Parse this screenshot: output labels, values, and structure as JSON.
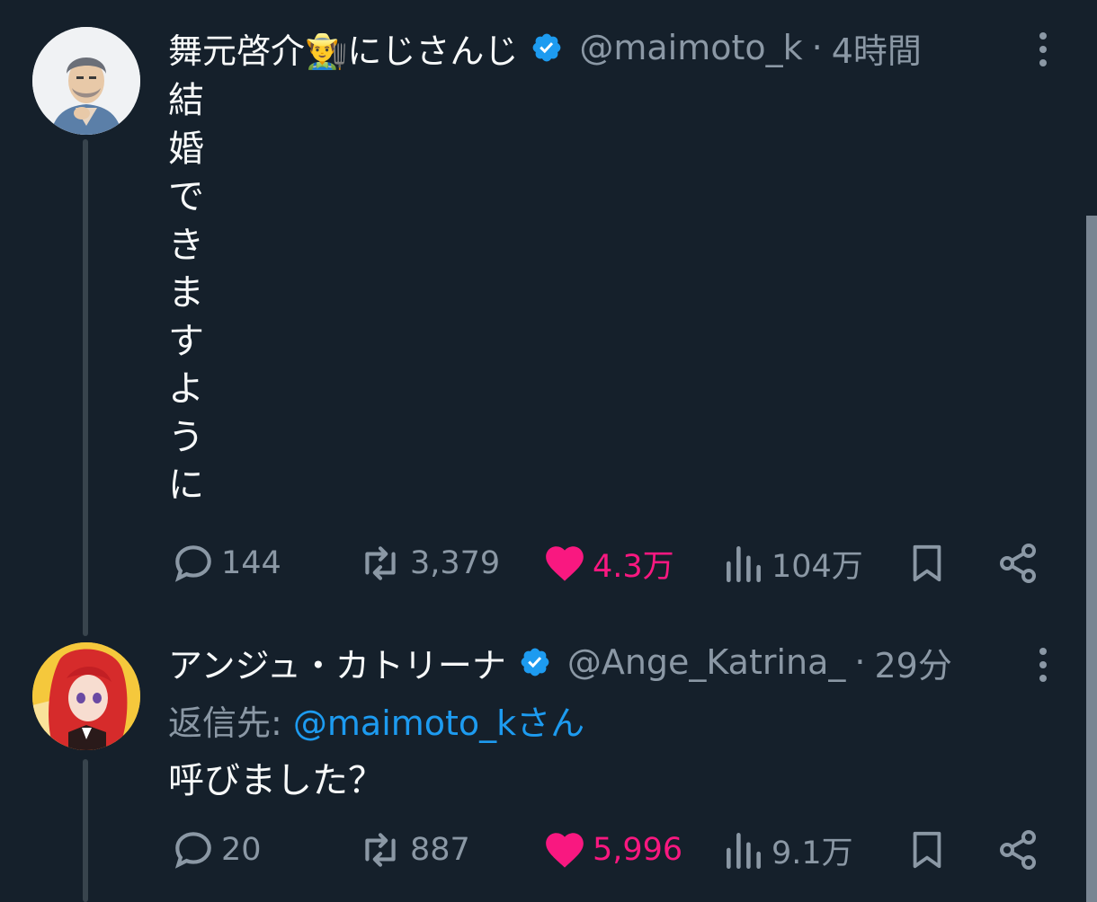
{
  "colors": {
    "background": "#15202b",
    "text": "#f7f9f9",
    "secondary": "#8b98a5",
    "link": "#1d9bf0",
    "like": "#f91880",
    "verified": "#1d9bf0"
  },
  "tweets": [
    {
      "display_name": "舞元啓介👨‍🌾にじさんじ",
      "handle": "@maimoto_k",
      "separator": "·",
      "time": "4時間",
      "verified": true,
      "text_chars": [
        "結",
        "婚",
        "で",
        "き",
        "ま",
        "す",
        "よ",
        "う",
        "に"
      ],
      "actions": {
        "reply": "144",
        "retweet": "3,379",
        "like": "4.3万",
        "views": "104万"
      }
    },
    {
      "display_name": "アンジュ・カトリーナ",
      "handle": "@Ange_Katrina_",
      "separator": "·",
      "time": "29分",
      "verified": true,
      "reply_label": "返信先: ",
      "reply_link": "@maimoto_k",
      "reply_suffix": "さん",
      "text": "呼びました？",
      "actions": {
        "reply": "20",
        "retweet": "887",
        "like": "5,996",
        "views": "9.1万"
      }
    }
  ]
}
